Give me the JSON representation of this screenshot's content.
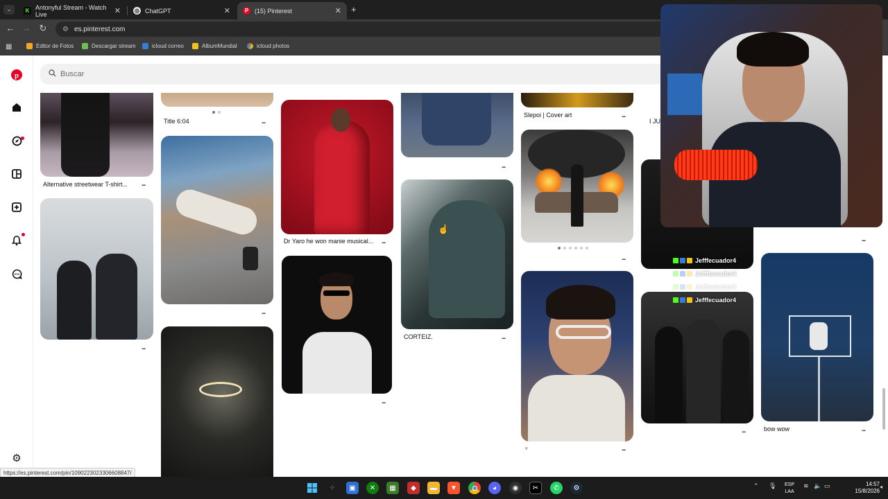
{
  "browser": {
    "tabs": [
      {
        "title": "Antonyful Stream - Watch Live",
        "icon": "kick-icon",
        "color": "#53fc18"
      },
      {
        "title": "ChatGPT",
        "icon": "chatgpt-icon",
        "color": "#666666"
      },
      {
        "title": "(15) Pinterest",
        "icon": "pinterest-icon",
        "color": "#e60023"
      }
    ],
    "new_tab": "+",
    "url": "es.pinterest.com",
    "bookmarks": [
      {
        "label": "Editor de Fotos",
        "color": "#f5a623"
      },
      {
        "label": "Descargar stream",
        "color": "#6fbf4e"
      },
      {
        "label": "icloud correo",
        "color": "#3a7bd5"
      },
      {
        "label": "AlbumMundial",
        "color": "#f0c419"
      },
      {
        "label": "icloud photos",
        "color": "#e0533d"
      }
    ]
  },
  "pinterest": {
    "search_placeholder": "Buscar",
    "pins": {
      "alt_streetwear": "Alternative streetwear T-shirt...",
      "title_604": "Title 6:04",
      "dr_yaro": "Dr Yaro he won manie musical...",
      "slepoi": "Slepoi | Cover art",
      "corteiz": "CORTEIZ.",
      "bow_wow": "bow wow",
      "i_just": "I JUS"
    },
    "more": "..."
  },
  "overlay": {
    "chat_user": "Jefffecuador4",
    "chat_user_dim": "Jefffecuador4"
  },
  "status_url": "https://es.pinterest.com/pin/1090223023306608847/",
  "tray": {
    "lang_top": "ESP",
    "lang_bottom": "LAA",
    "time": "14:57",
    "date": "15/8/2026"
  }
}
